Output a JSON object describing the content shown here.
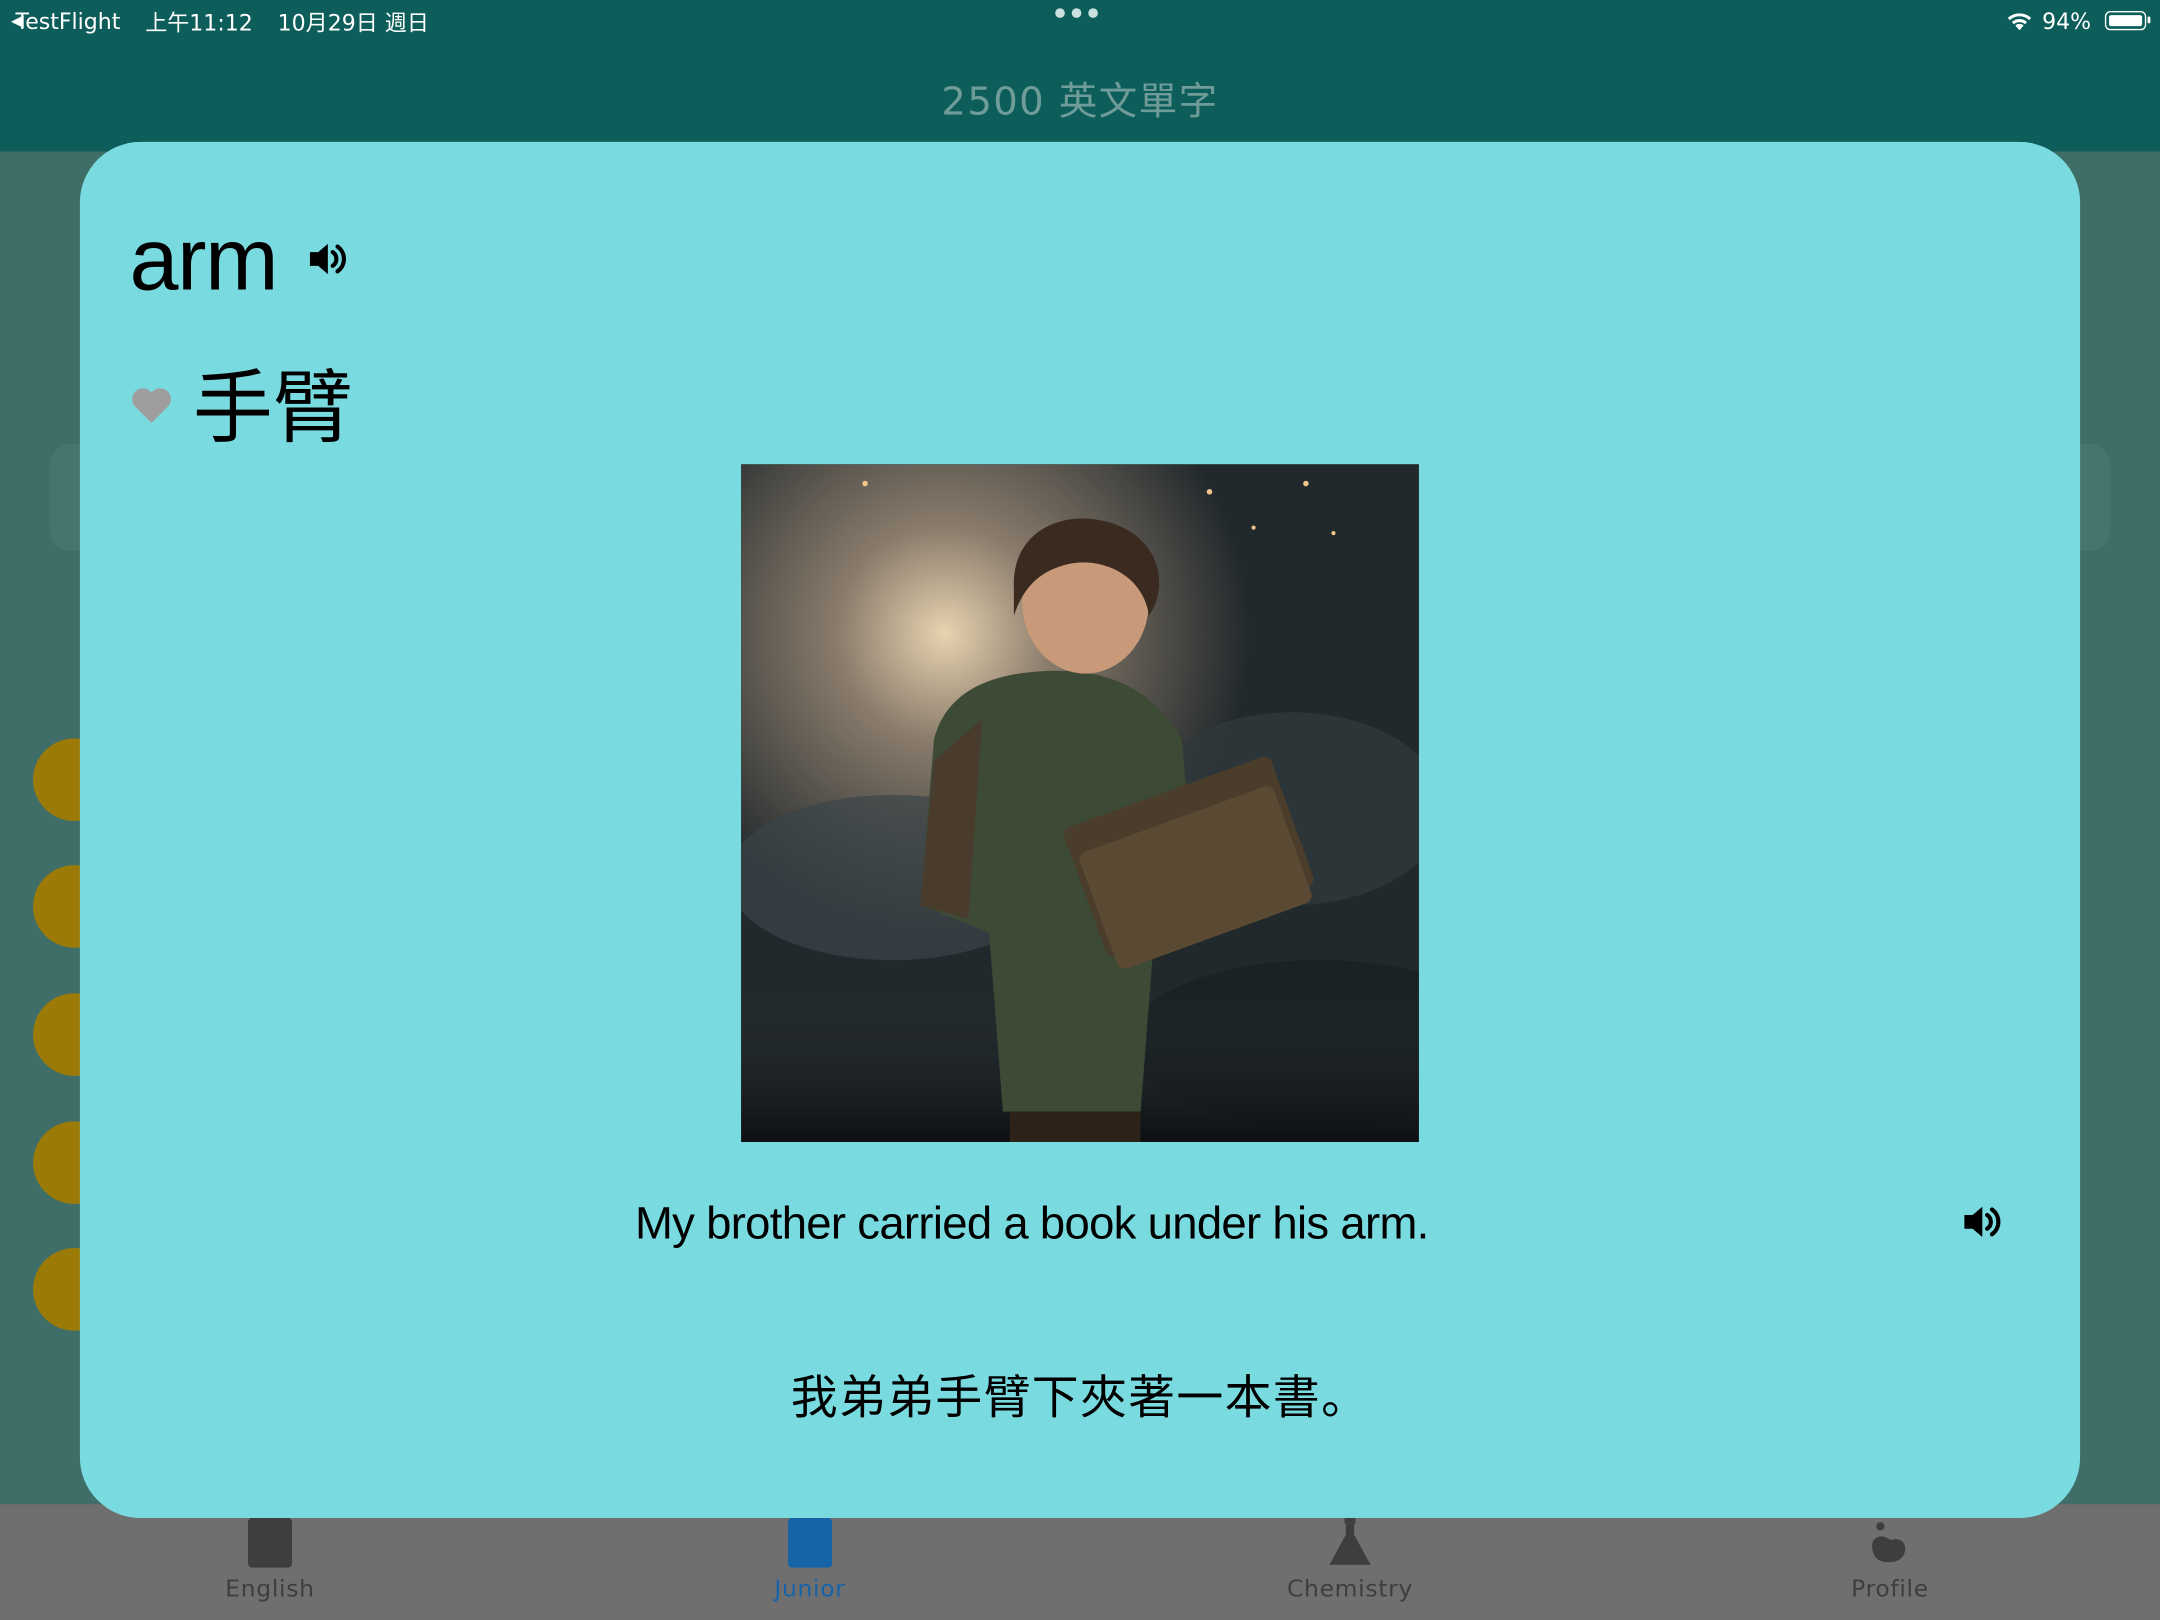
{
  "status_bar": {
    "back_app": "TestFlight",
    "time": "上午11:12",
    "date": "10月29日 週日",
    "battery": "94%"
  },
  "nav": {
    "title": "2500 英文單字"
  },
  "card": {
    "word": "arm",
    "meaning": "手臂",
    "favorite_icon": "heart-icon",
    "speaker_icon": "speaker-icon",
    "sentence_en": "My brother carried a book under his arm.",
    "sentence_zh": "我弟弟手臂下夾著一本書。"
  },
  "tabs": [
    {
      "label": "English",
      "icon": "book-icon",
      "active": false
    },
    {
      "label": "Junior",
      "icon": "book-icon",
      "active": true
    },
    {
      "label": "Chemistry",
      "icon": "flask-icon",
      "active": false
    },
    {
      "label": "Profile",
      "icon": "hand-icon",
      "active": false
    }
  ],
  "colors": {
    "nav_bg": "#0d5e5a",
    "card_bg": "#79dae0",
    "active_tab": "#1763a8",
    "heart": "#9e9e9e"
  }
}
